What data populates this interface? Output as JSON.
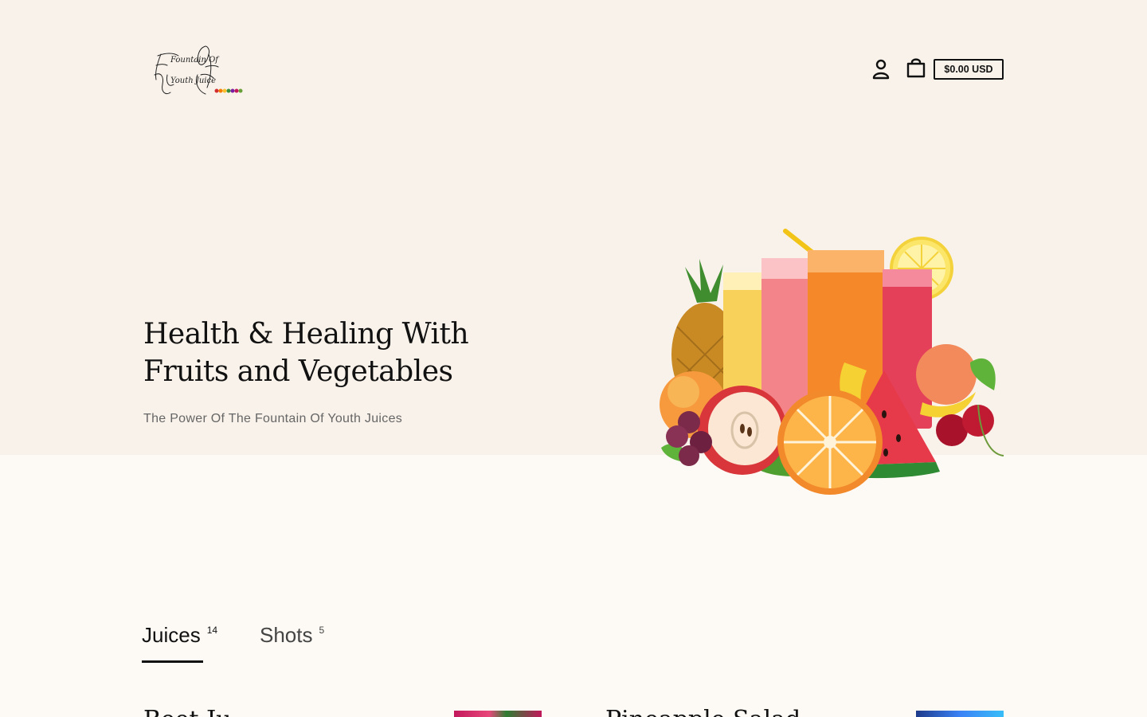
{
  "header": {
    "logo_text": [
      "Fountain Of",
      "Youth Juice"
    ],
    "cart_total": "$0.00 USD",
    "account_icon": "account-icon",
    "cart_icon": "shopping-bag-icon"
  },
  "hero": {
    "title": "Health & Healing With Fruits and Vegetables",
    "subtitle": "The Power Of The Fountain Of Youth Juices"
  },
  "tabs": [
    {
      "label": "Juices",
      "count": "14",
      "active": true
    },
    {
      "label": "Shots",
      "count": "5",
      "active": false
    }
  ],
  "products": [
    {
      "title": "Beet Ju..."
    },
    {
      "title": "Pineapple Salad"
    }
  ],
  "colors": {
    "hero_background": "#f9f2ea",
    "page_background": "#fdfaf5",
    "text": "#111111",
    "muted_text": "#666666"
  }
}
